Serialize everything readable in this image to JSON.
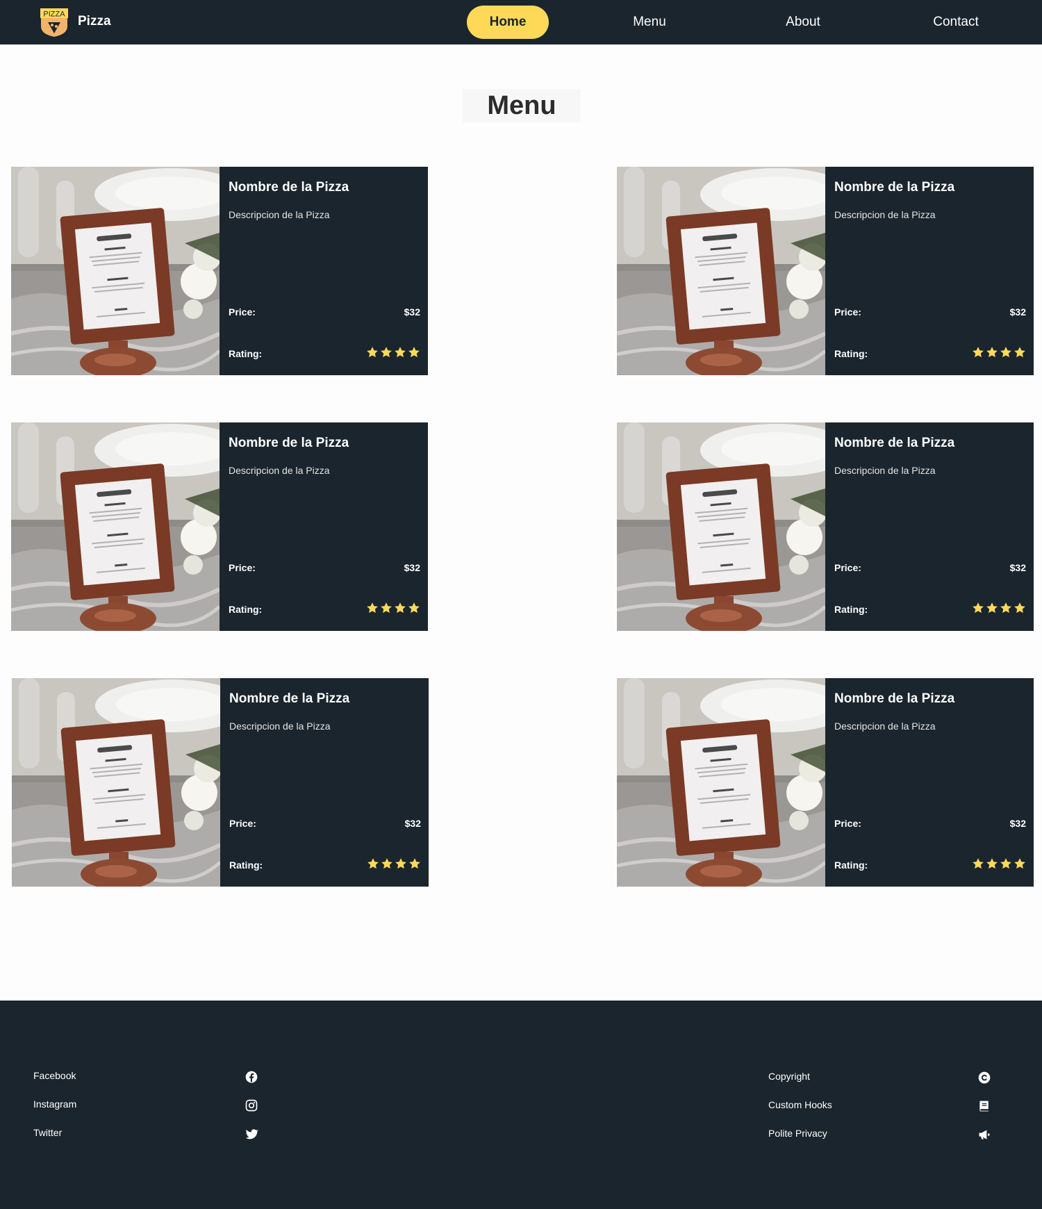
{
  "header": {
    "logo_text": "PIZZA",
    "brand": "Pizza",
    "nav": [
      "Home",
      "Menu",
      "About",
      "Contact"
    ],
    "active_nav": "Home",
    "accent_color": "#fed957",
    "bar_color": "#1a252d"
  },
  "page": {
    "title": "Menu"
  },
  "products": [
    {
      "name": "Nombre de la Pizza",
      "description": "Descripcion de la Pizza",
      "price_label": "Price:",
      "price": "$32",
      "rating_label": "Rating:",
      "rating": 4,
      "image": "menu-stand-photo"
    },
    {
      "name": "Nombre de la Pizza",
      "description": "Descripcion de la Pizza",
      "price_label": "Price:",
      "price": "$32",
      "rating_label": "Rating:",
      "rating": 4,
      "image": "menu-stand-photo"
    },
    {
      "name": "Nombre de la Pizza",
      "description": "Descripcion de la Pizza",
      "price_label": "Price:",
      "price": "$32",
      "rating_label": "Rating:",
      "rating": 4,
      "image": "menu-stand-photo"
    },
    {
      "name": "Nombre de la Pizza",
      "description": "Descripcion de la Pizza",
      "price_label": "Price:",
      "price": "$32",
      "rating_label": "Rating:",
      "rating": 4,
      "image": "menu-stand-photo"
    },
    {
      "name": "Nombre de la Pizza",
      "description": "Descripcion de la Pizza",
      "price_label": "Price:",
      "price": "$32",
      "rating_label": "Rating:",
      "rating": 4,
      "image": "menu-stand-photo"
    },
    {
      "name": "Nombre de la Pizza",
      "description": "Descripcion de la Pizza",
      "price_label": "Price:",
      "price": "$32",
      "rating_label": "Rating:",
      "rating": 4,
      "image": "menu-stand-photo"
    }
  ],
  "footer": {
    "social": [
      {
        "label": "Facebook",
        "icon": "facebook-icon"
      },
      {
        "label": "Instagram",
        "icon": "instagram-icon"
      },
      {
        "label": "Twitter",
        "icon": "twitter-icon"
      }
    ],
    "info": [
      {
        "label": "Copyright",
        "icon": "copyright-icon"
      },
      {
        "label": "Custom Hooks",
        "icon": "book-icon"
      },
      {
        "label": "Polite Privacy",
        "icon": "megaphone-icon"
      }
    ]
  }
}
